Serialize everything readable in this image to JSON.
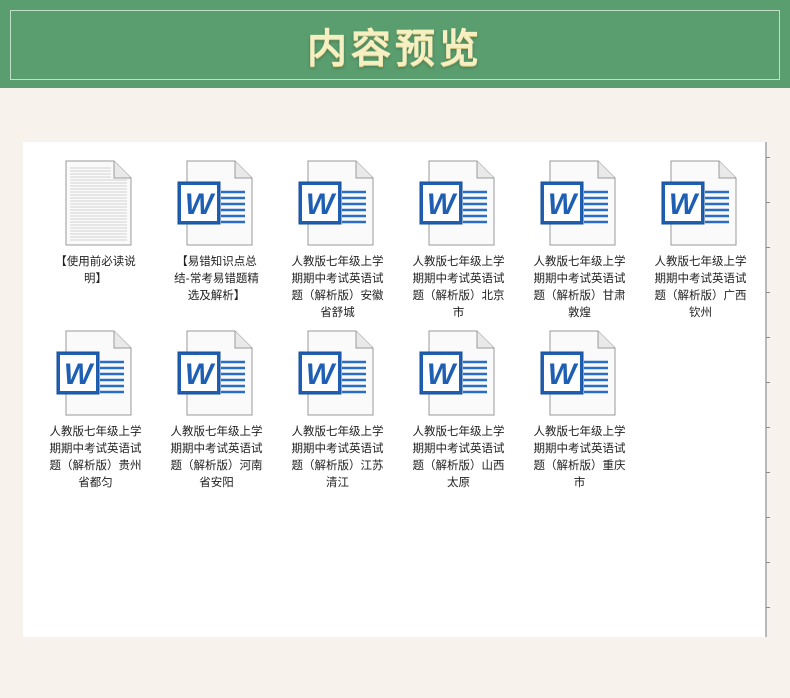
{
  "header": {
    "title": "内容预览"
  },
  "colors": {
    "header_green": "#5a9e6f",
    "title_cream": "#f6efc2",
    "word_blue": "#1e5fb3"
  },
  "files": [
    {
      "label": "【使用前必读说明】",
      "icon": "text-document-icon"
    },
    {
      "label": "【易错知识点总结-常考易错题精选及解析】",
      "icon": "word-document-icon"
    },
    {
      "label": "人教版七年级上学期期中考试英语试题（解析版）安徽省舒城",
      "icon": "word-document-icon"
    },
    {
      "label": "人教版七年级上学期期中考试英语试题（解析版）北京市",
      "icon": "word-document-icon"
    },
    {
      "label": "人教版七年级上学期期中考试英语试题（解析版）甘肃敦煌",
      "icon": "word-document-icon"
    },
    {
      "label": "人教版七年级上学期期中考试英语试题（解析版）广西钦州",
      "icon": "word-document-icon"
    },
    {
      "label": "人教版七年级上学期期中考试英语试题（解析版）贵州省都匀",
      "icon": "word-document-icon"
    },
    {
      "label": "人教版七年级上学期期中考试英语试题（解析版）河南省安阳",
      "icon": "word-document-icon"
    },
    {
      "label": "人教版七年级上学期期中考试英语试题（解析版）江苏清江",
      "icon": "word-document-icon"
    },
    {
      "label": "人教版七年级上学期期中考试英语试题（解析版）山西太原",
      "icon": "word-document-icon"
    },
    {
      "label": "人教版七年级上学期期中考试英语试题（解析版）重庆市",
      "icon": "word-document-icon"
    }
  ]
}
